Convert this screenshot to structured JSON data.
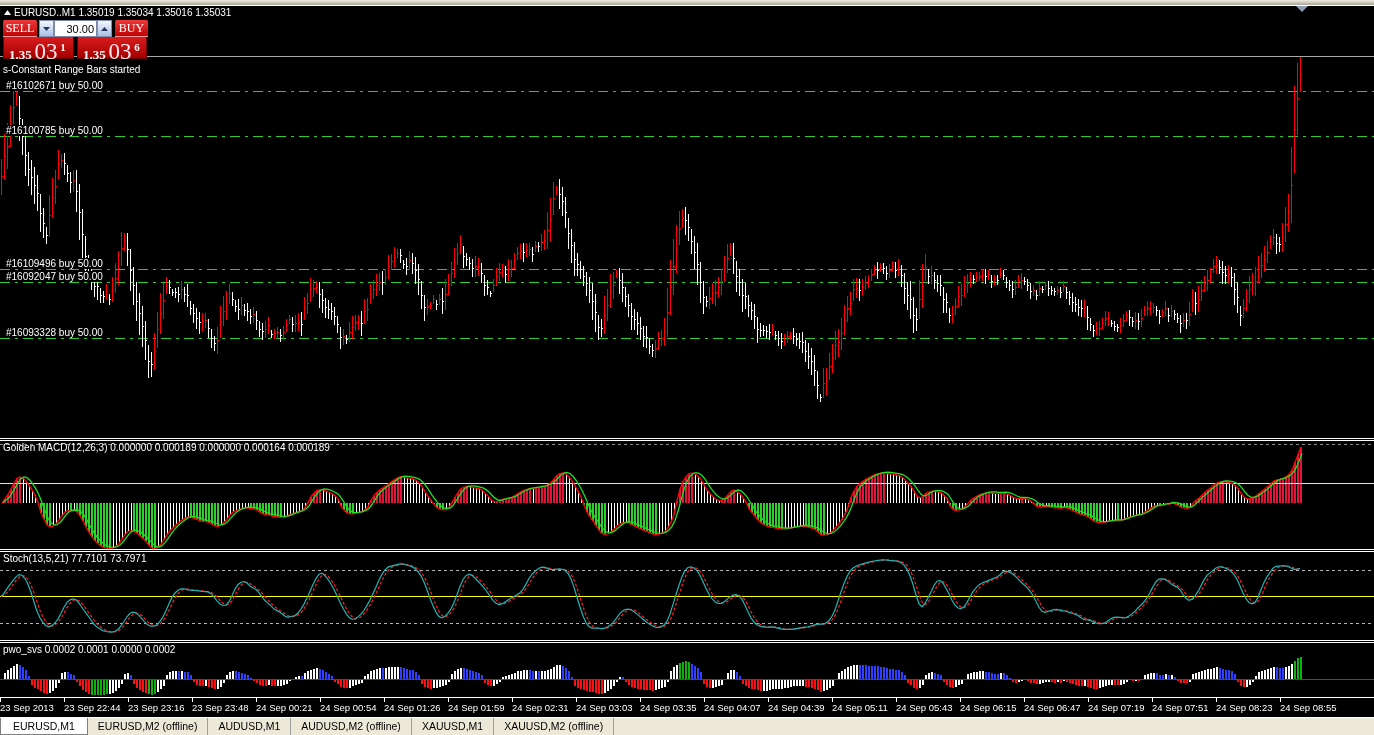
{
  "chart_header": {
    "symbol": "EURUSD..M1",
    "prices": [
      "1.35019",
      "1.35034",
      "1.35016",
      "1.35031"
    ]
  },
  "one_click_trading": {
    "sell": {
      "label": "SELL",
      "price_main": "1.35",
      "price_pips": "03",
      "price_point": "1"
    },
    "lot_size": "30.00",
    "buy": {
      "label": "BUY",
      "price_main": "1.35",
      "price_pips": "03",
      "price_point": "6"
    }
  },
  "status_message": "s-Constant Range Bars started",
  "order_lines": [
    {
      "label": "#16102671 buy 50.00"
    },
    {
      "label": "#16100785 buy 50.00"
    },
    {
      "label": "#16109496 buy 50.00"
    },
    {
      "label": "#16092047 buy 50.00"
    },
    {
      "label": "#16093328 buy 50.00"
    }
  ],
  "indicator_windows": [
    {
      "kind": "macd",
      "label": "Golden MACD(12,26,3) 0.000000 0.000189 0.000000 0.000164 0.000189"
    },
    {
      "kind": "stochastic",
      "label": "Stoch(13,5,21) 77.7101 73.7971"
    },
    {
      "kind": "pwo",
      "label": "pwo_svs 0.0002 0.0001 0.0000 0.0002"
    }
  ],
  "time_axis": {
    "labels": [
      "23 Sep 2013",
      "23 Sep 22:44",
      "23 Sep 23:16",
      "23 Sep 23:48",
      "24 Sep 00:21",
      "24 Sep 00:54",
      "24 Sep 01:26",
      "24 Sep 01:59",
      "24 Sep 02:31",
      "24 Sep 03:03",
      "24 Sep 03:35",
      "24 Sep 04:07",
      "24 Sep 04:39",
      "24 Sep 05:11",
      "24 Sep 05:43",
      "24 Sep 06:15",
      "24 Sep 06:47",
      "24 Sep 07:19",
      "24 Sep 07:51",
      "24 Sep 08:23",
      "24 Sep 08:55"
    ]
  },
  "tabs": [
    {
      "label": "EURUSD,M1",
      "selected": true
    },
    {
      "label": "EURUSD,M2 (offline)",
      "selected": false
    },
    {
      "label": "AUDUSD,M1",
      "selected": false
    },
    {
      "label": "AUDUSD,M2 (offline)",
      "selected": false
    },
    {
      "label": "XAUUSD,M1",
      "selected": false
    },
    {
      "label": "XAUUSD,M2 (offline)",
      "selected": false
    }
  ]
}
